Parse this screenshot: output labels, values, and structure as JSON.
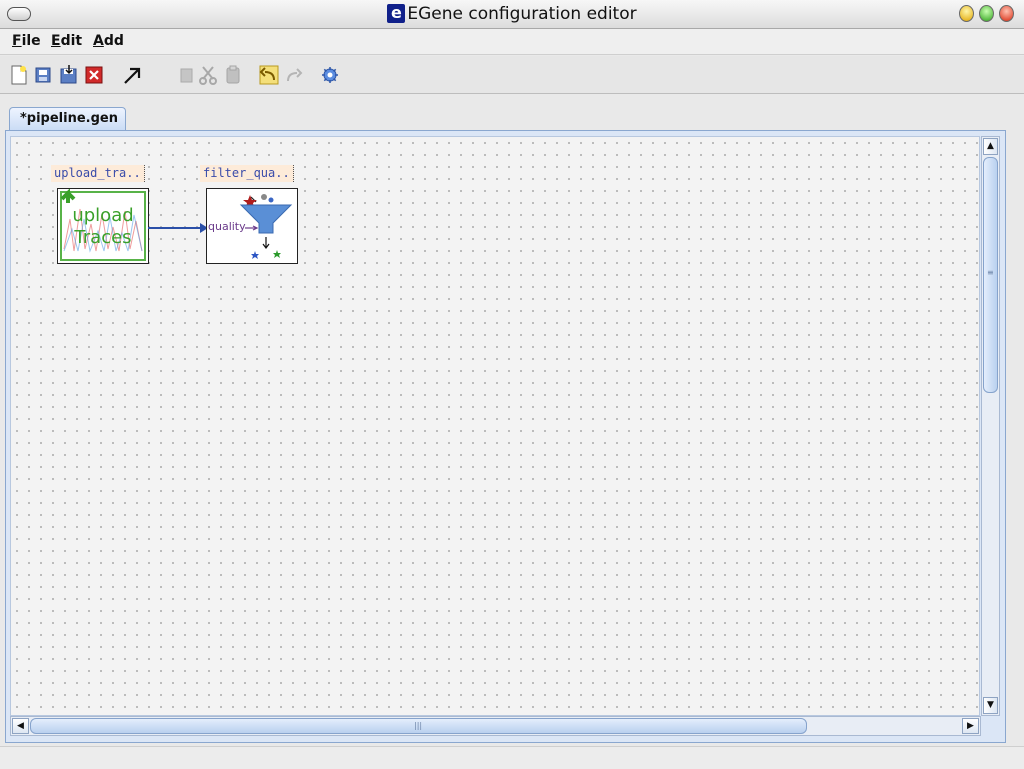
{
  "window": {
    "title": "EGene configuration editor",
    "logo_letter": "e"
  },
  "menu": {
    "file": {
      "mnemonic": "F",
      "rest": "ile"
    },
    "edit": {
      "mnemonic": "E",
      "rest": "dit"
    },
    "add": {
      "mnemonic": "A",
      "rest": "dd"
    }
  },
  "toolbar": {
    "icons": [
      "new-file-icon",
      "open-file-icon",
      "save-file-icon",
      "close-file-icon",
      "connect-arrow-icon",
      "copy-icon",
      "cut-icon",
      "paste-icon",
      "undo-icon",
      "redo-icon",
      "settings-gear-icon"
    ]
  },
  "tabs": [
    {
      "label": "*pipeline.gen"
    }
  ],
  "nodes": [
    {
      "label": "upload_tra..",
      "icon_text_line1": "upload",
      "icon_text_line2": "Traces"
    },
    {
      "label": "filter_qua..",
      "port_label": "quality"
    }
  ],
  "colors": {
    "accent": "#3a4caa",
    "connector": "#2a4fa8",
    "upload_green": "#3aa02a"
  }
}
